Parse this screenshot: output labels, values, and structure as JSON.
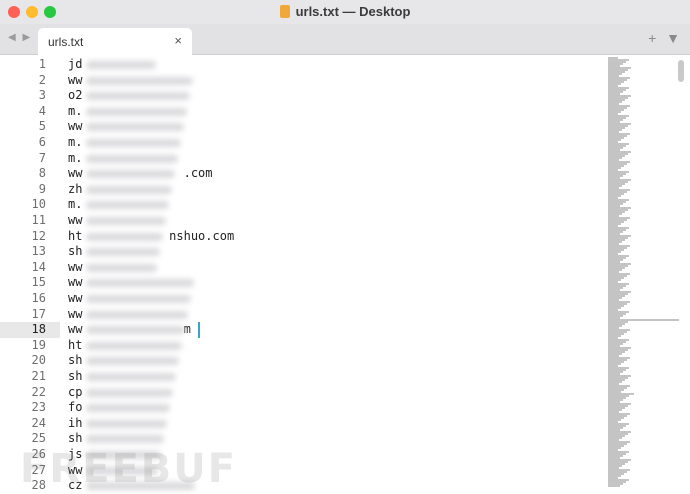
{
  "window": {
    "title": "urls.txt — Desktop"
  },
  "tabs": [
    {
      "label": "urls.txt",
      "close": "×"
    }
  ],
  "toolbar": {
    "nav_arrows": "◀ ▶",
    "add": "+",
    "menu": "▼"
  },
  "editor": {
    "active_line": 18,
    "lines": [
      {
        "n": "1",
        "text": "jd"
      },
      {
        "n": "2",
        "text": "ww"
      },
      {
        "n": "3",
        "text": "o2"
      },
      {
        "n": "4",
        "text": "m."
      },
      {
        "n": "5",
        "text": "ww"
      },
      {
        "n": "6",
        "text": "m."
      },
      {
        "n": "7",
        "text": "m."
      },
      {
        "n": "8",
        "text": "ww              .com"
      },
      {
        "n": "9",
        "text": "zh"
      },
      {
        "n": "10",
        "text": "m."
      },
      {
        "n": "11",
        "text": "ww"
      },
      {
        "n": "12",
        "text": "ht            nshuo.com"
      },
      {
        "n": "13",
        "text": "sh"
      },
      {
        "n": "14",
        "text": "ww"
      },
      {
        "n": "15",
        "text": "ww"
      },
      {
        "n": "16",
        "text": "ww"
      },
      {
        "n": "17",
        "text": "ww"
      },
      {
        "n": "18",
        "text": "ww              m"
      },
      {
        "n": "19",
        "text": "ht"
      },
      {
        "n": "20",
        "text": "sh"
      },
      {
        "n": "21",
        "text": "sh"
      },
      {
        "n": "22",
        "text": "cp"
      },
      {
        "n": "23",
        "text": "fo"
      },
      {
        "n": "24",
        "text": "ih"
      },
      {
        "n": "25",
        "text": "sh"
      },
      {
        "n": "26",
        "text": "js"
      },
      {
        "n": "27",
        "text": "ww"
      },
      {
        "n": "28",
        "text": "cz"
      }
    ]
  },
  "watermark": "FREEBUF",
  "colors": {
    "titlebar": "#e7e6e8",
    "cursor": "#3aa3c9",
    "active_line_bg": "#e8e8e8"
  }
}
